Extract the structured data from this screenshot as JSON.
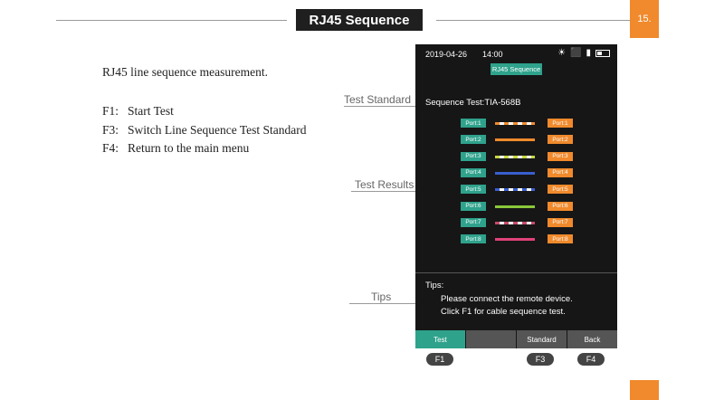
{
  "header": {
    "title": "RJ45 Sequence",
    "page_number": "15."
  },
  "intro": "RJ45 line sequence measurement.",
  "function_keys": [
    {
      "key": "F1:",
      "desc": "Start Test"
    },
    {
      "key": "F3:",
      "desc": "Switch Line Sequence Test Standard"
    },
    {
      "key": "F4:",
      "desc": "Return to the main menu"
    }
  ],
  "callouts": {
    "standard": "Test Standard",
    "results": "Test Results",
    "tips": "Tips"
  },
  "device": {
    "date": "2019-04-26",
    "time": "14:00",
    "status_icons": [
      "lightbulb-icon",
      "usb-icon",
      "sd-card-icon",
      "battery-icon"
    ],
    "screen_title": "RJ45 Sequence",
    "sequence_standard": "Sequence Test:TIA-568B",
    "ports": [
      {
        "left": "Port:1",
        "right": "Port:1",
        "wire": "white-orange"
      },
      {
        "left": "Port:2",
        "right": "Port:2",
        "wire": "orange"
      },
      {
        "left": "Port:3",
        "right": "Port:3",
        "wire": "white-green"
      },
      {
        "left": "Port:4",
        "right": "Port:4",
        "wire": "blue"
      },
      {
        "left": "Port:5",
        "right": "Port:5",
        "wire": "white-blue"
      },
      {
        "left": "Port:6",
        "right": "Port:6",
        "wire": "green"
      },
      {
        "left": "Port:7",
        "right": "Port:7",
        "wire": "white-brown"
      },
      {
        "left": "Port:8",
        "right": "Port:8",
        "wire": "pink"
      }
    ],
    "wire_colors": {
      "white-orange": "#f08a2c",
      "orange": "#f08a2c",
      "white-green": "#c8d83a",
      "blue": "#3a5fcf",
      "white-blue": "#3a5fcf",
      "green": "#8bc83a",
      "white-brown": "#c84a6a",
      "pink": "#e0427a"
    },
    "tips_title": "Tips:",
    "tips_lines": [
      "Please connect the remote device.",
      "Click F1 for cable sequence test."
    ],
    "function_bar": [
      "Test",
      "",
      "Standard",
      "Back"
    ],
    "keys": [
      "F1",
      "F3",
      "F4"
    ]
  },
  "colors": {
    "accent_teal": "#2fa28c",
    "accent_orange": "#f08a2c",
    "screen_bg": "#161616"
  }
}
